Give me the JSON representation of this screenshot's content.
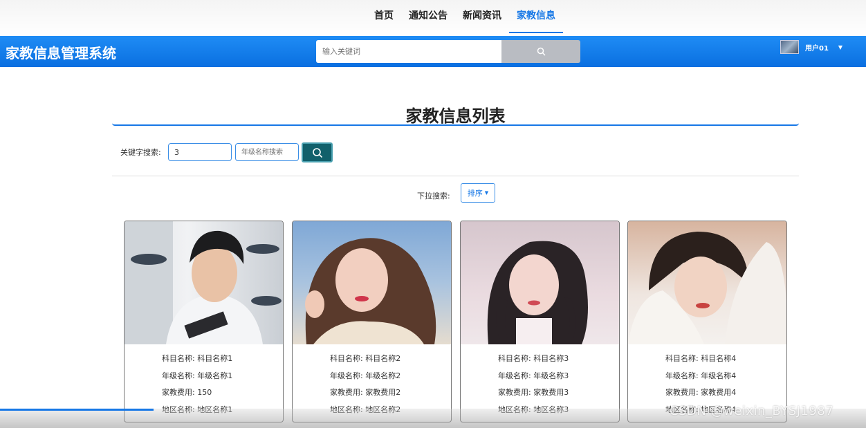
{
  "nav": {
    "items": [
      {
        "label": "首页"
      },
      {
        "label": "通知公告"
      },
      {
        "label": "新闻资讯"
      },
      {
        "label": "家教信息"
      }
    ],
    "active_index": 3
  },
  "header": {
    "site_title": "家教信息管理系统",
    "search_placeholder": "输入关键词",
    "user_name": "用户01"
  },
  "page": {
    "title": "家教信息列表",
    "keyword_label": "关键字搜索:",
    "keyword_value": "3",
    "grade_placeholder": "年级名称搜索",
    "dropdown_label": "下拉搜索:",
    "sort_label": "排序"
  },
  "cards": [
    {
      "subject_label": "科目名称:",
      "subject": "科目名称1",
      "grade_label": "年级名称:",
      "grade": "年级名称1",
      "fee_label": "家教费用:",
      "fee": "150",
      "region_label": "地区名称:",
      "region": "地区名称1"
    },
    {
      "subject_label": "科目名称:",
      "subject": "科目名称2",
      "grade_label": "年级名称:",
      "grade": "年级名称2",
      "fee_label": "家教费用:",
      "fee": "家教费用2",
      "region_label": "地区名称:",
      "region": "地区名称2"
    },
    {
      "subject_label": "科目名称:",
      "subject": "科目名称3",
      "grade_label": "年级名称:",
      "grade": "年级名称3",
      "fee_label": "家教费用:",
      "fee": "家教费用3",
      "region_label": "地区名称:",
      "region": "地区名称3"
    },
    {
      "subject_label": "科目名称:",
      "subject": "科目名称4",
      "grade_label": "年级名称:",
      "grade": "年级名称4",
      "fee_label": "家教费用:",
      "fee": "家教费用4",
      "region_label": "地区名称:",
      "region": "地区名称4"
    }
  ],
  "overlay": {
    "watermark": "CSDN @weixin_BYSJ1987"
  },
  "colors": {
    "brand_blue": "#1677e6",
    "filter_button": "#11606b"
  },
  "icons": {
    "search": "search-icon",
    "caret": "caret-down-icon",
    "avatar": "avatar"
  }
}
